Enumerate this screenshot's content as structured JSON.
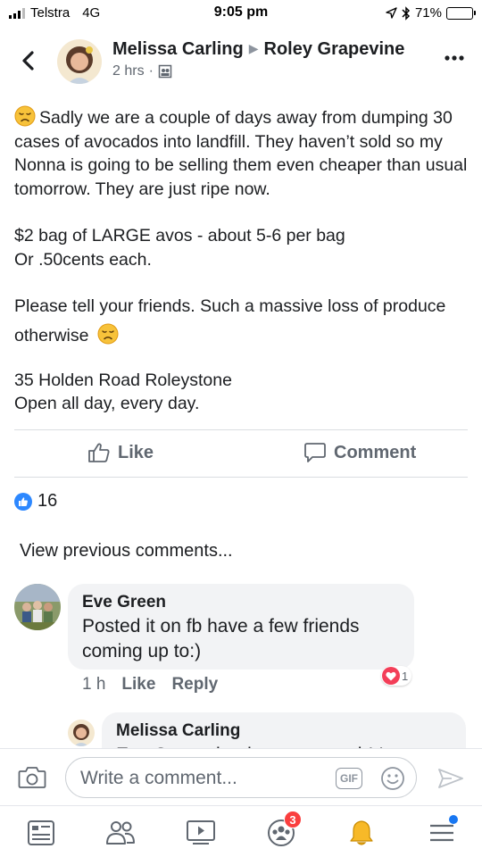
{
  "status_bar": {
    "carrier": "Telstra",
    "network": "4G",
    "time": "9:05 pm",
    "battery": "71%",
    "battery_level": 0.71
  },
  "post": {
    "author": "Melissa Carling",
    "group": "Roley Grapevine",
    "time": "2 hrs",
    "body": {
      "p1": "Sadly we are a couple of days away from dumping 30 cases of avocados into landfill. They haven’t sold so my Nonna is going to be selling them even cheaper than usual tomorrow. They are just ripe now.",
      "p2_line1": "$2 bag of LARGE avos - about 5-6 per bag",
      "p2_line2": "Or .50cents each.",
      "p3": "Please tell your friends. Such a massive loss of produce otherwise",
      "p4_line1": "35 Holden Road Roleystone",
      "p4_line2": "Open all day, every day."
    },
    "like_label": "Like",
    "comment_label": "Comment",
    "reaction_count": "16"
  },
  "comments": {
    "view_previous": "View previous comments...",
    "items": [
      {
        "author": "Eve Green",
        "text": "Posted it on fb  have a few friends coming up to:)",
        "time": "1 h",
        "like_label": "Like",
        "reply_label": "Reply",
        "reaction_count": "1"
      },
      {
        "author": "Melissa Carling",
        "text": "Eve Green thank you so much! I was"
      }
    ]
  },
  "composer": {
    "placeholder": "Write a comment...",
    "gif_label": "GIF"
  },
  "tabbar": {
    "notification_count": "3"
  },
  "colors": {
    "accent": "#1877f2",
    "text": "#1c1e21",
    "secondary_text": "#606770",
    "bubble": "#f2f3f5",
    "badge_red": "#fa3e3e"
  },
  "icons": [
    "signal-icon",
    "location-arrow-icon",
    "bluetooth-icon",
    "battery-icon",
    "back-chevron-icon",
    "group-privacy-icon",
    "more-dots-icon",
    "like-thumb-icon",
    "comment-icon",
    "camera-icon",
    "gif-icon",
    "smiley-icon",
    "send-icon",
    "news-feed-icon",
    "friends-icon",
    "watch-icon",
    "groups-icon",
    "bell-icon",
    "menu-icon"
  ]
}
